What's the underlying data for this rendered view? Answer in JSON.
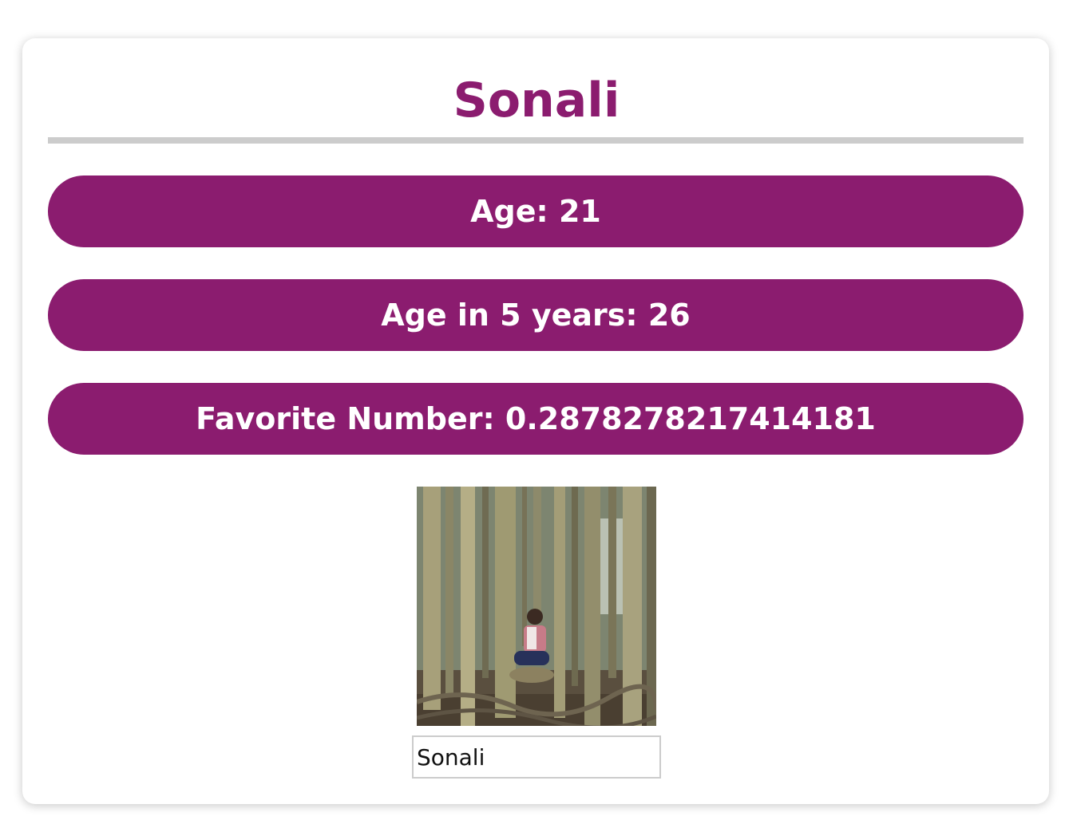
{
  "profile": {
    "name": "Sonali",
    "age_label": "Age: 21",
    "age_future_label": "Age in 5 years: 26",
    "favorite_number_label": "Favorite Number: 0.2878278217414181",
    "name_input_value": "Sonali"
  },
  "colors": {
    "accent": "#8b1c6f",
    "divider": "#cccccc",
    "pill_text": "#ffffff"
  },
  "photo": {
    "subject": "person-sitting-among-banyan-tree-roots"
  }
}
